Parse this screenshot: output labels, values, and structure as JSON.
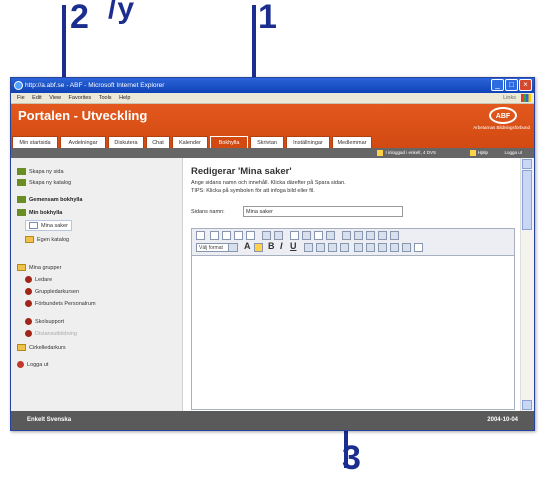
{
  "annotations": {
    "top_cut_text": "/y",
    "label_1": "1",
    "label_2": "2",
    "label_3": "3"
  },
  "browser": {
    "title": "http://a.abf.se - ABF - Microsoft Internet Explorer",
    "menu": [
      "Fie",
      "Edit",
      "View",
      "Favorites",
      "Tools",
      "Help"
    ],
    "toolbar_right": "Links",
    "window_buttons": [
      "_",
      "□",
      "×"
    ]
  },
  "portal": {
    "title": "Portalen - Utveckling",
    "logo": "ABF",
    "logo_subtitle": "Arbetarnas Bildningsförbund",
    "accent_color": "#d24a12",
    "tabs": [
      {
        "label": "Min startsida",
        "active": false
      },
      {
        "label": "Avdelningar",
        "active": false
      },
      {
        "label": "Diskutera",
        "active": false
      },
      {
        "label": "Chat",
        "active": false
      },
      {
        "label": "Kalender",
        "active": false
      },
      {
        "label": "Bokhylla",
        "active": true
      },
      {
        "label": "Skrivtan",
        "active": false
      },
      {
        "label": "Inställningar",
        "active": false
      },
      {
        "label": "Medlemmar",
        "active": false
      }
    ],
    "status": {
      "logged_in": "I inloggad i enkelt, 4 DVS",
      "help": "Hjälp",
      "logout": "Logga ut"
    }
  },
  "sidebar": {
    "items": [
      {
        "label": "Skapa ny sida",
        "icon": "green-square-icon"
      },
      {
        "label": "Skapa ny katalog",
        "icon": "green-square-icon"
      },
      {
        "label": "Gemensam bokhylla",
        "icon": "green-square-icon"
      },
      {
        "label": "Min bokhylla",
        "icon": "green-square-icon"
      },
      {
        "label": "Mina saker",
        "icon": "page-icon"
      },
      {
        "label": "Egen katalog",
        "icon": "folder-icon"
      },
      {
        "label": "Mina grupper",
        "icon": "folder-icon"
      },
      {
        "label": "Ledare",
        "icon": "person-icon"
      },
      {
        "label": "Gruppledarkursen",
        "icon": "person-icon"
      },
      {
        "label": "Förbundets Personalrum",
        "icon": "person-icon"
      },
      {
        "label": "Skolsupport",
        "icon": "person-icon"
      },
      {
        "label": "Distansutbildning",
        "icon": "person-icon"
      },
      {
        "label": "Cirkelledarkurs",
        "icon": "folder-icon"
      },
      {
        "label": "Logga ut",
        "icon": "logout-icon"
      }
    ]
  },
  "editor": {
    "heading": "Redigerar 'Mina saker'",
    "instruction_line": "Ange sidans namn och innehåll. Klicka därefter på Spara sidan.",
    "tip_line": "TIPS: Klicka på symbolen för att infoga bild eller fil.",
    "name_label": "Sidans namn:",
    "name_value": "Mina saker",
    "font_select": "Välj format"
  },
  "footer": {
    "left": "Enkelt Svenska",
    "right": "2004-10-04"
  }
}
